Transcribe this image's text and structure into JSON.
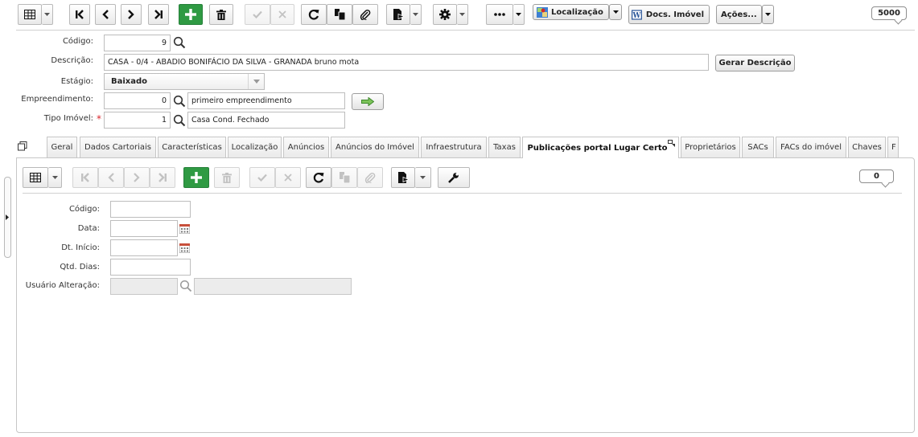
{
  "toolbar": {
    "buttons": [
      {
        "name": "grid-view-icon"
      },
      {
        "name": "first-record-icon"
      },
      {
        "name": "previous-record-icon"
      },
      {
        "name": "next-record-icon"
      },
      {
        "name": "last-record-icon"
      },
      {
        "name": "add-icon"
      },
      {
        "name": "delete-icon"
      },
      {
        "name": "confirm-icon"
      },
      {
        "name": "cancel-icon"
      },
      {
        "name": "refresh-icon"
      },
      {
        "name": "copy-icon"
      },
      {
        "name": "attach-icon"
      },
      {
        "name": "export-icon"
      },
      {
        "name": "settings-icon"
      },
      {
        "name": "more-icon"
      }
    ],
    "localizacao_label": "Localização",
    "docs_label": "Docs. Imóvel",
    "acoes_label": "Ações...",
    "record_count": "5000"
  },
  "form": {
    "codigo": {
      "label": "Código:",
      "value": "9"
    },
    "descricao": {
      "label": "Descrição:",
      "value": "CASA - 0/4 - ABADIO BONIFÁCIO DA SILVA - GRANADA bruno mota"
    },
    "gerar_descricao_label": "Gerar Descrição",
    "estagio": {
      "label": "Estágio:",
      "value": "Baixado"
    },
    "empreendimento": {
      "label": "Empreendimento:",
      "code": "0",
      "name": "primeiro empreendimento"
    },
    "tipo_imovel": {
      "label": "Tipo Imóvel:",
      "required_mark": "*",
      "code": "1",
      "name": "Casa Cond. Fechado"
    }
  },
  "tabs": [
    {
      "label": "Geral",
      "active": false
    },
    {
      "label": "Dados Cartoriais",
      "active": false
    },
    {
      "label": "Características",
      "active": false
    },
    {
      "label": "Localização",
      "active": false
    },
    {
      "label": "Anúncios",
      "active": false
    },
    {
      "label": "Anúncios do Imóvel",
      "active": false
    },
    {
      "label": "Infraestrutura",
      "active": false
    },
    {
      "label": "Taxas",
      "active": false
    },
    {
      "label": "Publicações portal Lugar Certo",
      "active": true
    },
    {
      "label": "Proprietários",
      "active": false
    },
    {
      "label": "SACs",
      "active": false
    },
    {
      "label": "FACs do imóvel",
      "active": false
    },
    {
      "label": "Chaves",
      "active": false
    },
    {
      "label": "F",
      "active": false
    }
  ],
  "subform": {
    "record_count": "0",
    "codigo": {
      "label": "Código:",
      "value": ""
    },
    "data": {
      "label": "Data:",
      "value": ""
    },
    "dt_inicio": {
      "label": "Dt. Início:",
      "value": ""
    },
    "qtd_dias": {
      "label": "Qtd. Dias:",
      "value": ""
    },
    "usuario_alteracao": {
      "label": "Usuário Alteração:",
      "code": "",
      "name": ""
    }
  },
  "colors": {
    "accent_green": "#2f9a43",
    "required": "#d9262c",
    "border": "#c6c6c6"
  }
}
